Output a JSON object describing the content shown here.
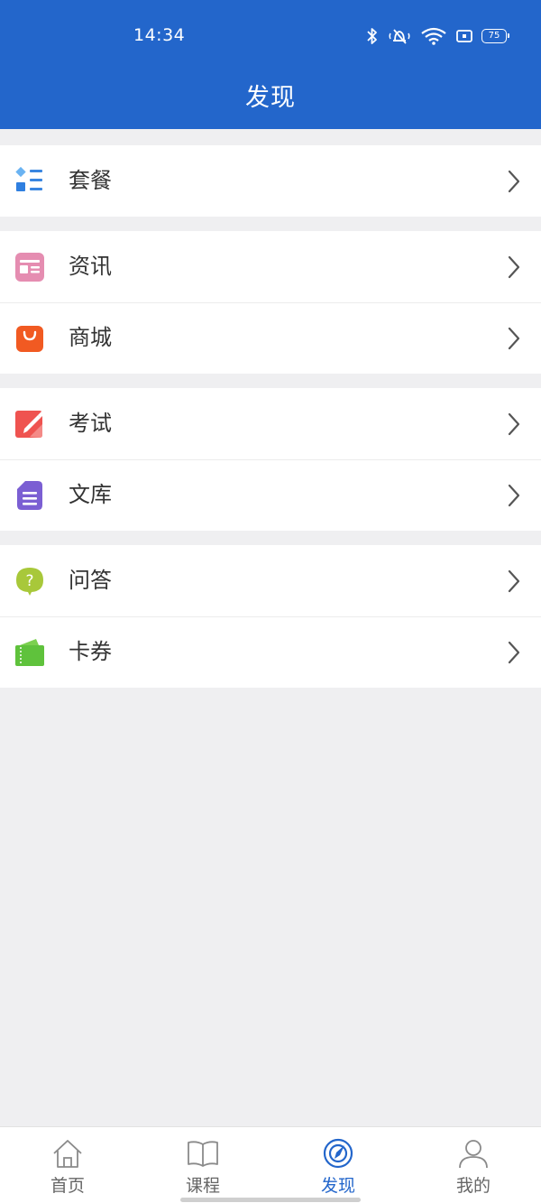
{
  "status_bar": {
    "time": "14:34",
    "battery": "75"
  },
  "header": {
    "title": "发现"
  },
  "groups": [
    {
      "items": [
        {
          "label": "套餐",
          "icon": "package-icon",
          "color": "#3a86e0"
        }
      ]
    },
    {
      "items": [
        {
          "label": "资讯",
          "icon": "news-icon",
          "color": "#e58db1"
        },
        {
          "label": "商城",
          "icon": "shopping-bag-icon",
          "color": "#f15a22"
        }
      ]
    },
    {
      "items": [
        {
          "label": "考试",
          "icon": "exam-pencil-icon",
          "color": "#ef5350"
        },
        {
          "label": "文库",
          "icon": "document-icon",
          "color": "#7b5fd3"
        }
      ]
    },
    {
      "items": [
        {
          "label": "问答",
          "icon": "question-bubble-icon",
          "color": "#a8c83a"
        },
        {
          "label": "卡券",
          "icon": "coupon-icon",
          "color": "#5fc23c"
        }
      ]
    }
  ],
  "tabbar": {
    "tabs": [
      {
        "label": "首页",
        "icon": "home-icon",
        "active": false
      },
      {
        "label": "课程",
        "icon": "book-icon",
        "active": false
      },
      {
        "label": "发现",
        "icon": "discover-icon",
        "active": true
      },
      {
        "label": "我的",
        "icon": "user-icon",
        "active": false
      }
    ],
    "active_color": "#2366cb",
    "inactive_color": "#666666"
  },
  "colors": {
    "header_bg": "#2366cb",
    "page_bg": "#efeff1"
  }
}
